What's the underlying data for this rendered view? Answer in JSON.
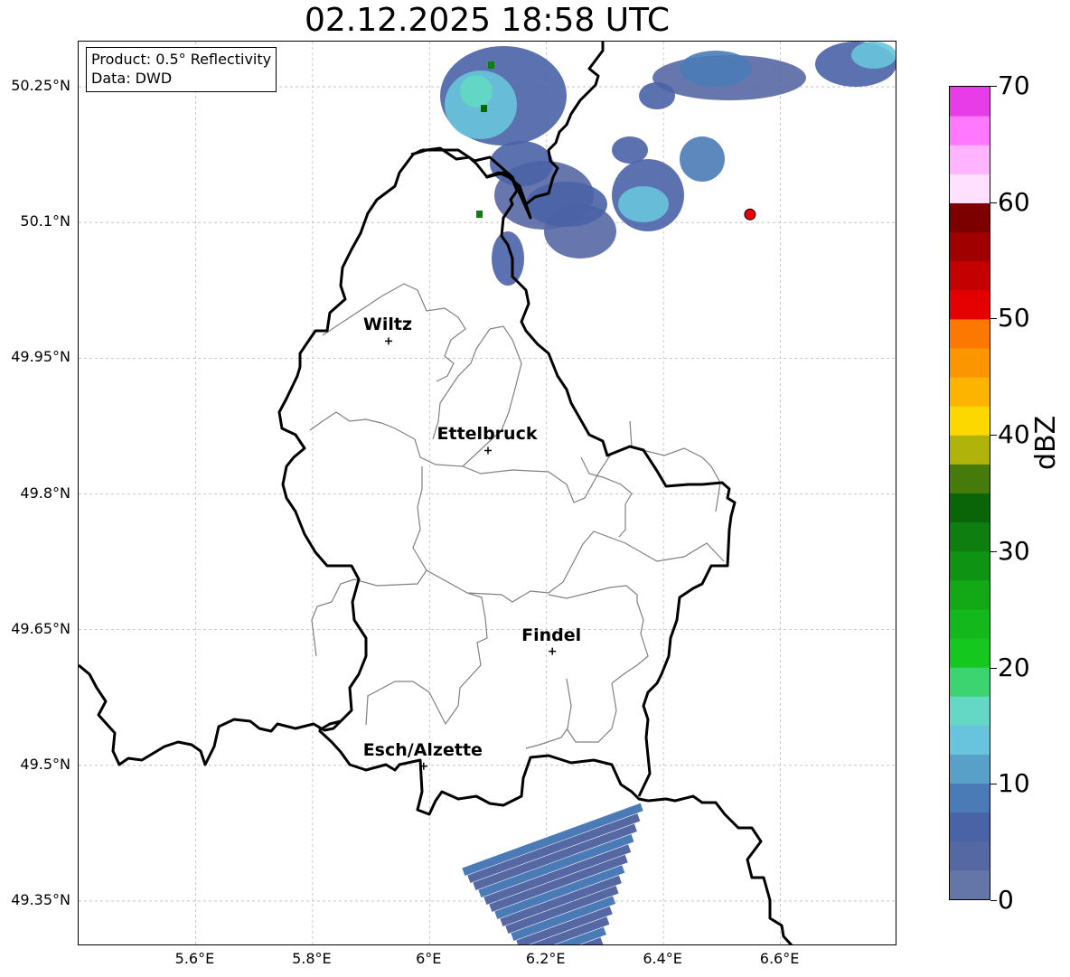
{
  "title": "02.12.2025 18:58 UTC",
  "info_box": {
    "product_line": "Product: 0.5° Reflectivity",
    "data_line": "Data: DWD"
  },
  "axes": {
    "lon_range": [
      5.4,
      6.8
    ],
    "lat_range": [
      49.3,
      50.3
    ],
    "x_ticks": [
      {
        "value": 5.6,
        "label": "5.6°E"
      },
      {
        "value": 5.8,
        "label": "5.8°E"
      },
      {
        "value": 6.0,
        "label": "6°E"
      },
      {
        "value": 6.2,
        "label": "6.2°E"
      },
      {
        "value": 6.4,
        "label": "6.4°E"
      },
      {
        "value": 6.6,
        "label": "6.6°E"
      }
    ],
    "y_ticks": [
      {
        "value": 50.25,
        "label": "50.25°N"
      },
      {
        "value": 50.1,
        "label": "50.1°N"
      },
      {
        "value": 49.95,
        "label": "49.95°N"
      },
      {
        "value": 49.8,
        "label": "49.8°N"
      },
      {
        "value": 49.65,
        "label": "49.65°N"
      },
      {
        "value": 49.5,
        "label": "49.5°N"
      },
      {
        "value": 49.35,
        "label": "49.35°N"
      }
    ],
    "grid": true
  },
  "cities": [
    {
      "name": "Wiltz",
      "lon": 5.93,
      "lat": 49.969
    },
    {
      "name": "Ettelbruck",
      "lon": 6.1,
      "lat": 49.848
    },
    {
      "name": "Findel",
      "lon": 6.21,
      "lat": 49.626
    },
    {
      "name": "Esch/Alzette",
      "lon": 5.99,
      "lat": 49.499
    }
  ],
  "radar_site": {
    "lon": 6.548,
    "lat": 50.109,
    "color": "#e8000b"
  },
  "colorbar": {
    "label": "dBZ",
    "ticks": [
      "0",
      "10",
      "20",
      "30",
      "40",
      "50",
      "60",
      "70"
    ],
    "min": 0,
    "max": 70,
    "step": 2.5,
    "colors": [
      "#6475a8",
      "#5668a4",
      "#4a62a6",
      "#4a7bb6",
      "#58a0c8",
      "#68c4dc",
      "#64d8c4",
      "#3cd470",
      "#14c81e",
      "#12b81c",
      "#12a816",
      "#0e9412",
      "#0e7e10",
      "#0a6408",
      "#467a0a",
      "#b0b40a",
      "#fcd800",
      "#fcb400",
      "#fc9600",
      "#fc7800",
      "#e40000",
      "#c40000",
      "#a00000",
      "#7c0000",
      "#ffe0ff",
      "#ffb4ff",
      "#ff78ff",
      "#e83ce8"
    ]
  },
  "legend_colors": {
    "border_country": "#000000",
    "border_canton": "#808080"
  }
}
